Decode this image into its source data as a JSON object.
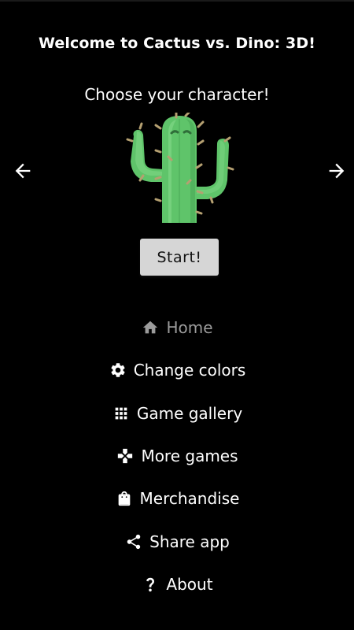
{
  "header": {
    "title": "Welcome to Cactus vs. Dino: 3D!",
    "subtitle": "Choose your character!"
  },
  "carousel": {
    "prev_icon": "arrow-left-icon",
    "next_icon": "arrow-right-icon",
    "character_icon": "cactus-icon"
  },
  "start_button": {
    "label": "Start!"
  },
  "menu": {
    "items": [
      {
        "label": "Home",
        "icon": "home-icon",
        "active": true
      },
      {
        "label": "Change colors",
        "icon": "gear-icon",
        "active": false
      },
      {
        "label": "Game gallery",
        "icon": "grid-icon",
        "active": false
      },
      {
        "label": "More games",
        "icon": "gamepad-icon",
        "active": false
      },
      {
        "label": "Merchandise",
        "icon": "shopping-bag-icon",
        "active": false
      },
      {
        "label": "Share app",
        "icon": "share-icon",
        "active": false
      },
      {
        "label": "About",
        "icon": "question-icon",
        "active": false
      }
    ]
  },
  "colors": {
    "background": "#000000",
    "text": "#ffffff",
    "active_item": "#9b9b9b",
    "button_bg": "#d6d6d6",
    "cactus_green": "#5fc46a"
  }
}
